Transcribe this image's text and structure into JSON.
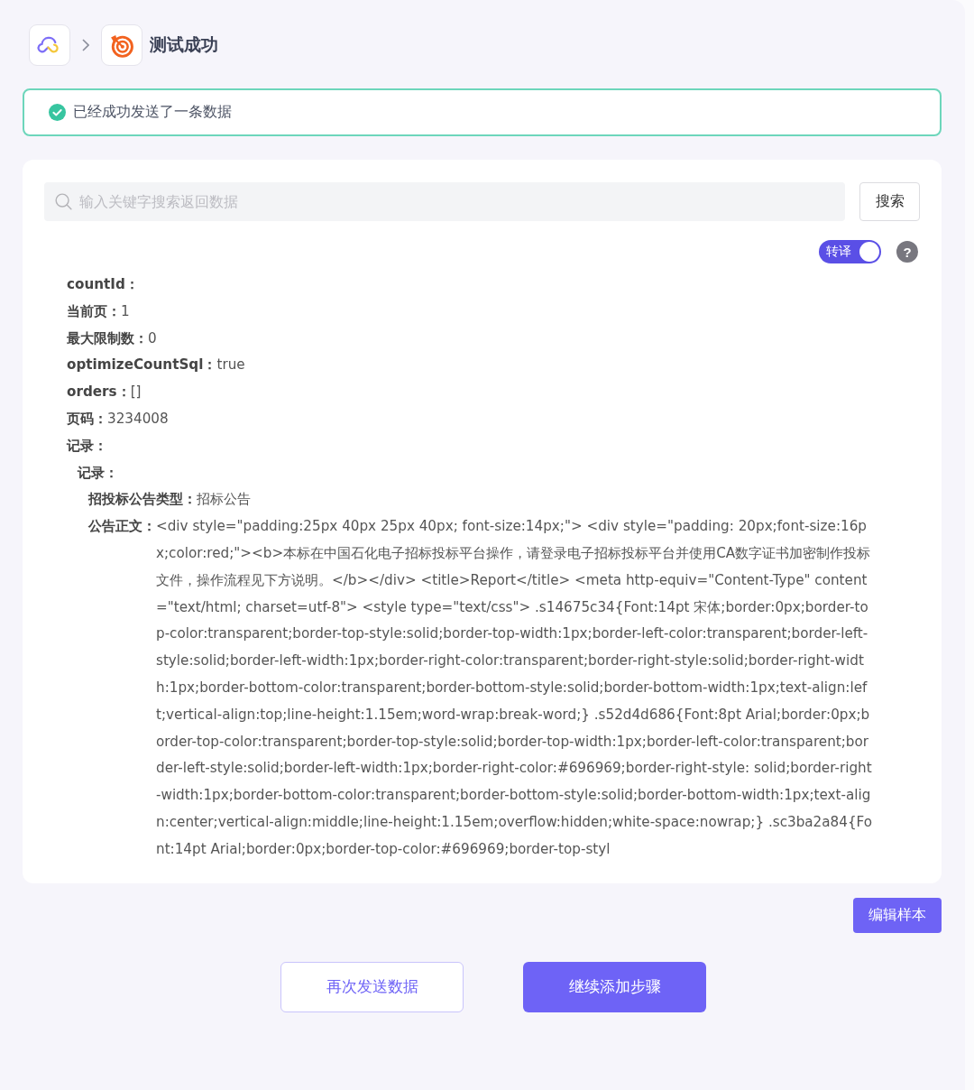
{
  "breadcrumb": {
    "title": "测试成功"
  },
  "alert": {
    "kind": "success",
    "message": "已经成功发送了一条数据"
  },
  "search": {
    "placeholder": "输入关键字搜索返回数据",
    "button": "搜索"
  },
  "translate_toggle": {
    "label": "转译",
    "on": true
  },
  "help_button": {
    "label": "?"
  },
  "fields": [
    {
      "label": "countId："
    },
    {
      "label": "当前页：",
      "value": "1"
    },
    {
      "label": "最大限制数：",
      "value": "0"
    },
    {
      "label": "optimizeCountSql：",
      "value": "true"
    },
    {
      "label": "orders：",
      "value": "[]"
    },
    {
      "label": "页码：",
      "value": "3234008"
    },
    {
      "label": "记录：",
      "children": [
        {
          "label": "记录：",
          "children": [
            {
              "label": "招投标公告类型：",
              "value": "招标公告"
            },
            {
              "label": "公告正文：",
              "value": "<div style=\"padding:25px 40px 25px 40px; font-size:14px;\"> <div style=\"padding: 20px;font-size:16px;color:red;\"><b>本标在中国石化电子招标投标平台操作，请登录电子招标投标平台并使用CA数字证书加密制作投标文件，操作流程见下方说明。</b></div> <title>Report</title> <meta http-equiv=\"Content-Type\" content=\"text/html; charset=utf-8\"> <style type=\"text/css\"> .s14675c34{Font:14pt 宋体;border:0px;border-top-color:transparent;border-top-style:solid;border-top-width:1px;border-left-color:transparent;border-left-style:solid;border-left-width:1px;border-right-color:transparent;border-right-style:solid;border-right-width:1px;border-bottom-color:transparent;border-bottom-style:solid;border-bottom-width:1px;text-align:left;vertical-align:top;line-height:1.15em;word-wrap:break-word;} .s52d4d686{Font:8pt Arial;border:0px;border-top-color:transparent;border-top-style:solid;border-top-width:1px;border-left-color:transparent;border-left-style:solid;border-left-width:1px;border-right-color:#696969;border-right-style: solid;border-right-width:1px;border-bottom-color:transparent;border-bottom-style:solid;border-bottom-width:1px;text-align:center;vertical-align:middle;line-height:1.15em;overflow:hidden;white-space:nowrap;} .sc3ba2a84{Font:14pt Arial;border:0px;border-top-color:#696969;border-top-styl"
            }
          ]
        }
      ]
    }
  ],
  "footer": {
    "edit_button": "编辑样本",
    "actions": [
      {
        "label": "再次发送数据",
        "kind": "secondary"
      },
      {
        "label": "继续添加步骤",
        "kind": "primary"
      }
    ]
  }
}
